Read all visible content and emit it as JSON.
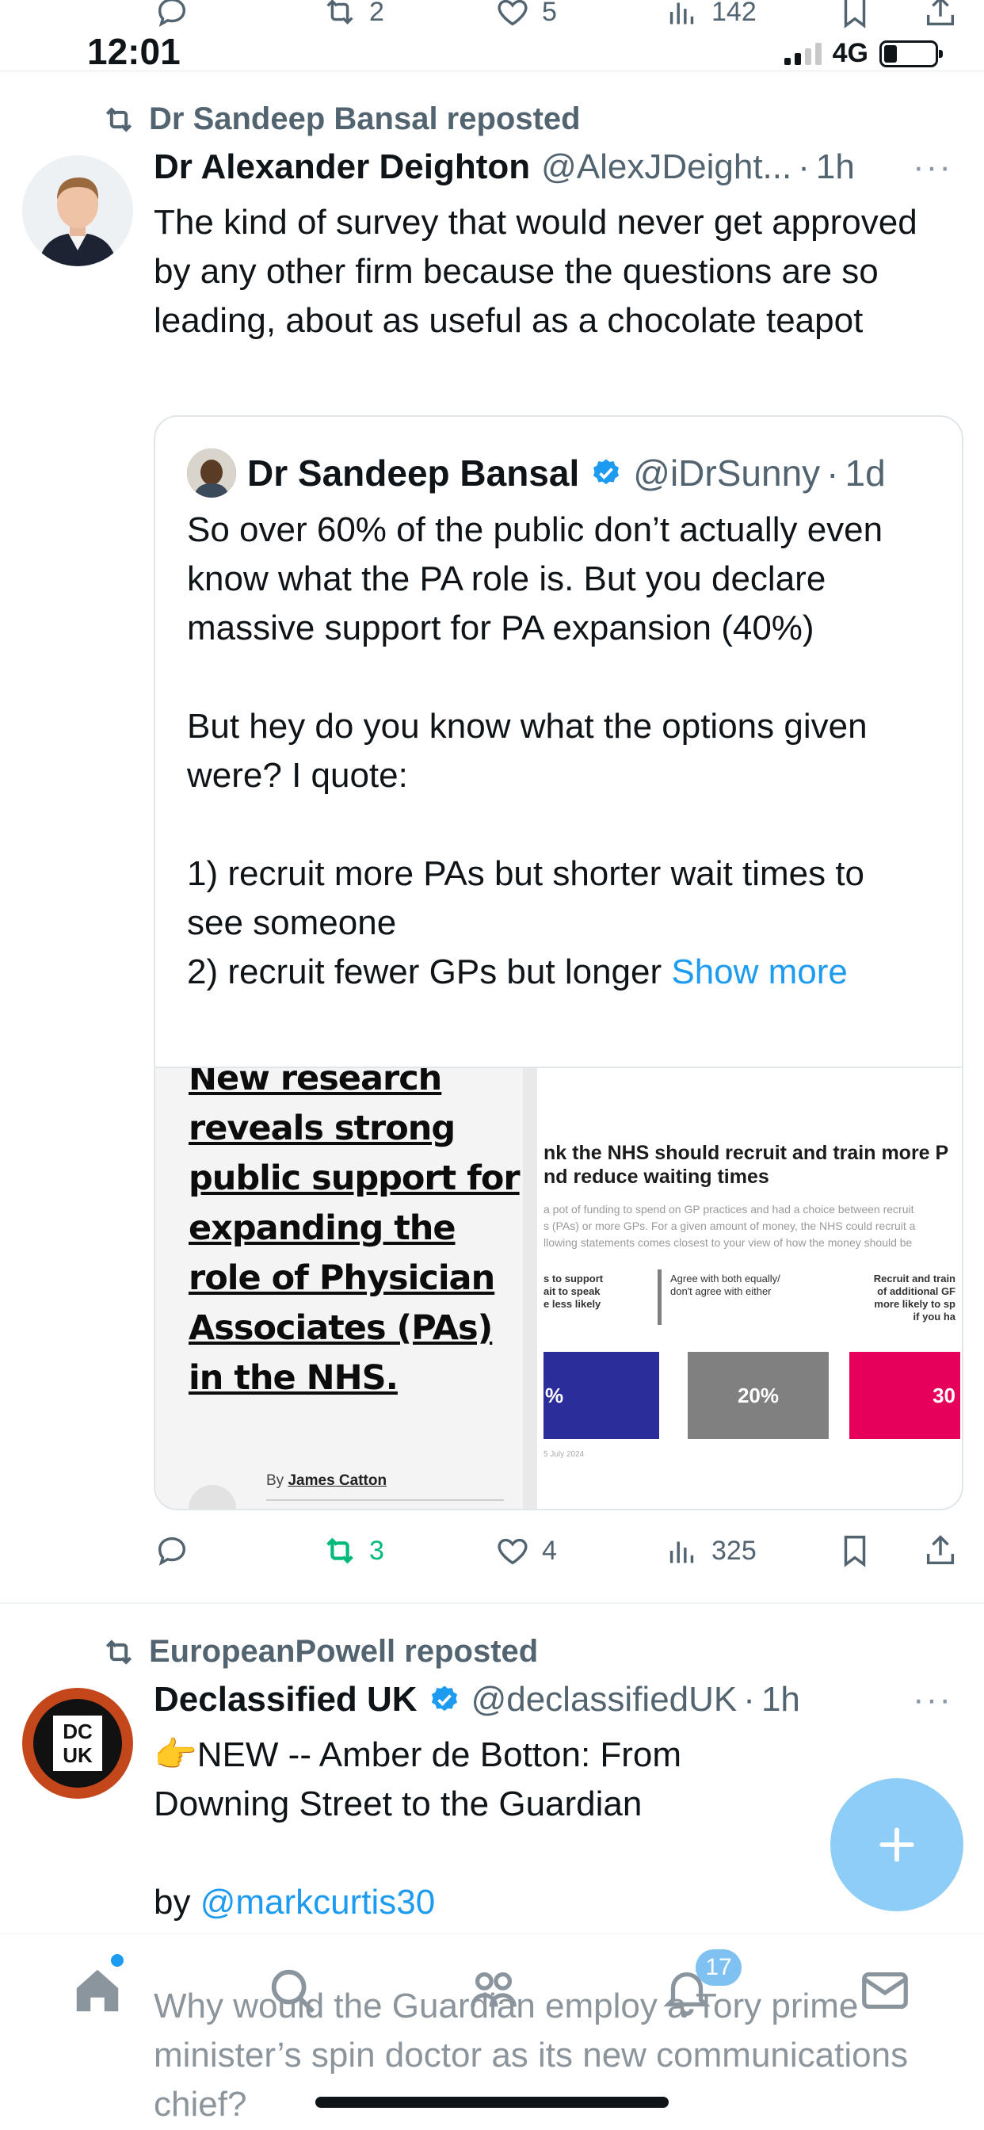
{
  "status": {
    "time": "12:01",
    "network": "4G"
  },
  "top_actions": {
    "replies": "",
    "reposts": "2",
    "likes": "5",
    "views": "142"
  },
  "post1": {
    "repost_by": "Dr Sandeep Bansal reposted",
    "name": "Dr Alexander Deighton",
    "handle": "@AlexJDeight...",
    "time": "1h",
    "text": "The kind of survey that would never get approved by any other firm because the questions are so leading, about as useful as a chocolate teapot",
    "quote": {
      "name": "Dr Sandeep Bansal",
      "handle": "@iDrSunny",
      "time": "1d",
      "text": "So over 60% of the public don’t actually even know what the PA role is. But you declare massive support for PA expansion (40%)\n\nBut hey do you know what the options given were? I quote:\n\n1) recruit more PAs but shorter wait times to see someone\n2) recruit fewer GPs but longer ",
      "show_more": "Show more",
      "article_headline": "New research reveals strong public support for expanding the role of Physician Associates (PAs) in the NHS.",
      "article_byline_prefix": "By",
      "article_author": "James Catton",
      "chart_title": "nk the NHS should recruit and train more P\nnd reduce waiting times",
      "chart_subtitle": "a pot of funding to spend on GP practices and had a choice between recruit\ns (PAs) or more GPs. For a given amount of money, the NHS could recruit a\nllowing statements comes closest to your view of how the money should be",
      "chart_source": "5 July 2024"
    },
    "actions": {
      "replies": "",
      "reposts": "3",
      "likes": "4",
      "views": "325"
    }
  },
  "chart_data": {
    "type": "bar",
    "categories": [
      "s to support\nait to speak\ne less likely",
      "Agree with both equally/\ndon't agree with either",
      "Recruit and train\nof additional GF\nmore likely to sp\nif you ha"
    ],
    "value_labels": [
      "%",
      "20%",
      "30"
    ],
    "colors": [
      "#2a2d9a",
      "#808080",
      "#e6005c"
    ]
  },
  "post2": {
    "repost_by": "EuropeanPowell reposted",
    "name": "Declassified UK",
    "handle": "@declassifiedUK",
    "time": "1h",
    "avatar_text_top": "DC",
    "avatar_text_bottom": "UK",
    "line1": "👉NEW -- Amber de Botton: From Downing Street to the Guardian",
    "by_prefix": "by ",
    "mention": "@markcurtis30",
    "line2": "Why would the Guardian employ a Tory prime minister’s spin doctor as its new communications chief?"
  },
  "nav": {
    "notifications_badge": "17"
  },
  "colors": {
    "accent": "#1d9bf0",
    "repost_green": "#00ba7c",
    "secondary_text": "#536471"
  }
}
